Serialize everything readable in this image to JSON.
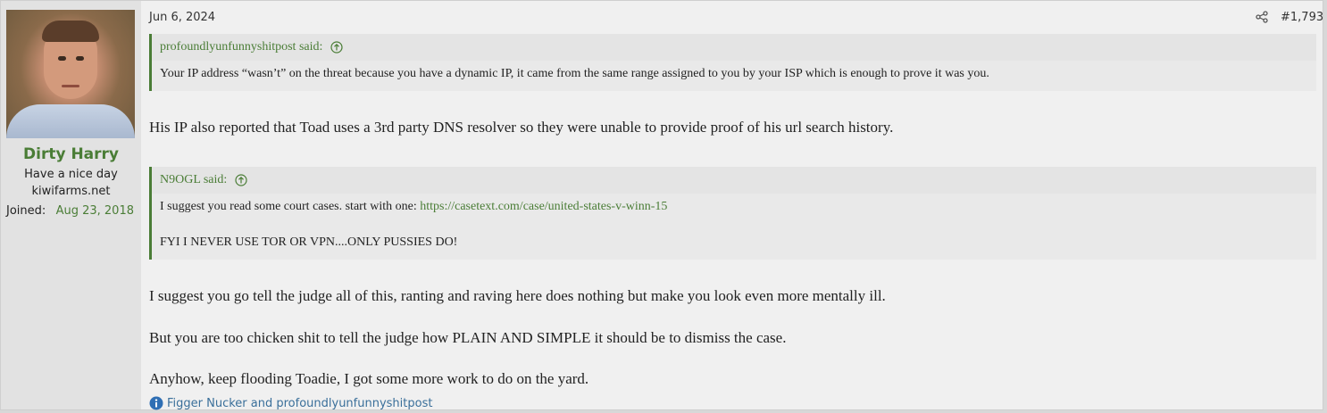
{
  "post": {
    "date": "Jun 6, 2024",
    "number": "#1,793",
    "icons": {
      "share": "share-icon",
      "quote_up": "arrow-up-circle-icon",
      "reactions": "info-icon"
    },
    "colors": {
      "accent": "#4a7d36",
      "reaction_link": "#3a6f9a"
    }
  },
  "user": {
    "name": "Dirty Harry",
    "title": "Have a nice day",
    "site": "kiwifarms.net",
    "joined_label": "Joined:",
    "joined_date": "Aug 23, 2018"
  },
  "quotes": [
    {
      "author": "profoundlyunfunnyshitpost said:",
      "lines": [
        "Your IP address “wasn’t” on the threat because you have a dynamic IP, it came from the same range assigned to you by your ISP which is enough to prove it was you."
      ]
    },
    {
      "author": "N9OGL said:",
      "line1_text": "I suggest you read some court cases. start with one: ",
      "line1_link": "https://casetext.com/case/united-states-v-winn-15",
      "line2": "FYI I NEVER USE TOR OR VPN....ONLY PUSSIES DO!"
    }
  ],
  "paragraphs": [
    "His IP also reported that Toad uses a 3rd party DNS resolver so they were unable to provide proof of his url search history.",
    "I suggest you go tell the judge all of this, ranting and raving here does nothing but make you look even more mentally ill.",
    "But you are too chicken shit to tell the judge how PLAIN AND SIMPLE it should be to dismiss the case.",
    "Anyhow, keep flooding Toadie, I got some more work to do on the yard."
  ],
  "reactions": "Figger Nucker and profoundlyunfunnyshitpost"
}
